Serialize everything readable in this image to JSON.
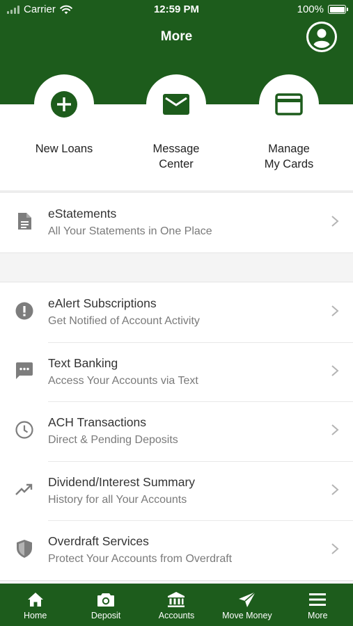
{
  "status_bar": {
    "carrier": "Carrier",
    "time": "12:59 PM",
    "battery": "100%"
  },
  "header": {
    "title": "More",
    "profile_icon": "user-circle-icon"
  },
  "quick_actions": [
    {
      "label_line1": "New Loans",
      "label_line2": "",
      "icon": "plus-circle-icon"
    },
    {
      "label_line1": "Message",
      "label_line2": "Center",
      "icon": "envelope-icon"
    },
    {
      "label_line1": "Manage",
      "label_line2": "My Cards",
      "icon": "credit-card-icon"
    }
  ],
  "list_primary": [
    {
      "title": "eStatements",
      "subtitle": "All Your Statements in One Place",
      "icon": "document-icon"
    }
  ],
  "list_secondary": [
    {
      "title": "eAlert Subscriptions",
      "subtitle": "Get Notified of Account Activity",
      "icon": "alert-icon"
    },
    {
      "title": "Text Banking",
      "subtitle": "Access Your Accounts via Text",
      "icon": "chat-icon"
    },
    {
      "title": "ACH Transactions",
      "subtitle": "Direct & Pending Deposits",
      "icon": "clock-icon"
    },
    {
      "title": "Dividend/Interest Summary",
      "subtitle": "History for all Your Accounts",
      "icon": "trending-up-icon"
    },
    {
      "title": "Overdraft Services",
      "subtitle": "Protect Your Accounts from Overdraft",
      "icon": "shield-icon"
    }
  ],
  "tabbar": [
    {
      "label": "Home",
      "icon": "home-icon"
    },
    {
      "label": "Deposit",
      "icon": "camera-icon"
    },
    {
      "label": "Accounts",
      "icon": "bank-icon"
    },
    {
      "label": "Move Money",
      "icon": "send-icon"
    },
    {
      "label": "More",
      "icon": "menu-icon"
    }
  ],
  "colors": {
    "brand_green": "#1d5c1c",
    "icon_gray": "#7d7d7d",
    "background": "#f4f4f4"
  }
}
